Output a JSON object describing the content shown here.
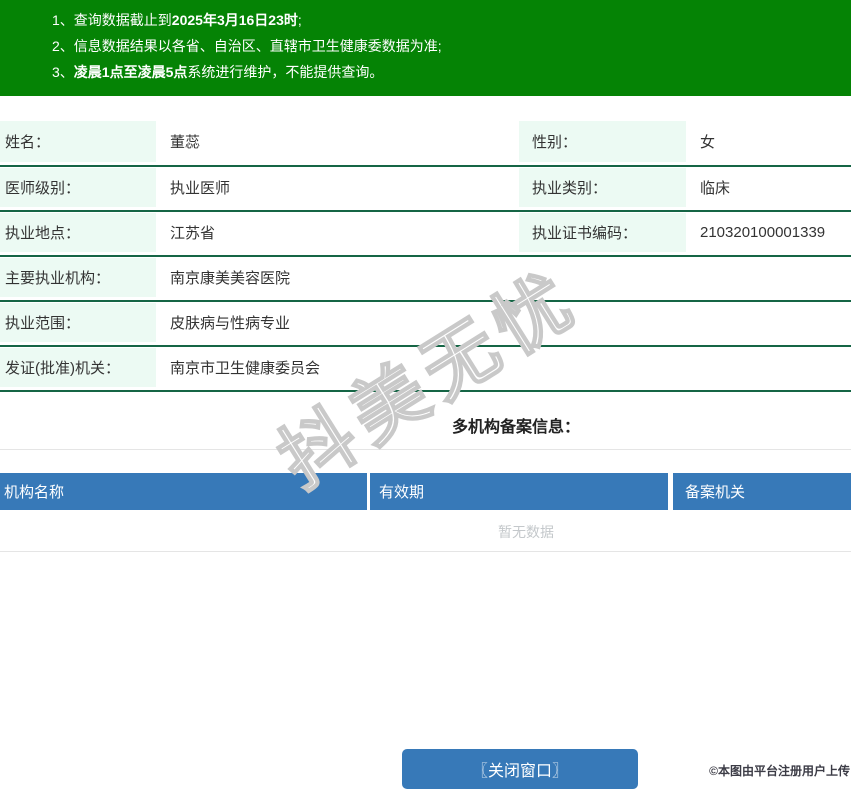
{
  "banner": {
    "lines": [
      {
        "pre": "1、查询数据截止到",
        "bold": "2025年3月16日23时",
        "post": ";"
      },
      {
        "pre": "2、信息数据结果以各省、自治区、直辖市卫生健康委数据为准;",
        "bold": "",
        "post": ""
      },
      {
        "pre": "3、",
        "bold": "凌晨1点至凌晨5点",
        "post": "系统进行维护，不能提供查询。"
      }
    ]
  },
  "info": {
    "rows": [
      {
        "label": "姓名：",
        "value": "董蕊",
        "label2": "性别：",
        "value2": "女"
      },
      {
        "label": "医师级别：",
        "value": "执业医师",
        "label2": "执业类别：",
        "value2": "临床"
      },
      {
        "label": "执业地点：",
        "value": "江苏省",
        "label2": "执业证书编码：",
        "value2": "210320100001339"
      },
      {
        "label": "主要执业机构：",
        "value": "南京康美美容医院"
      },
      {
        "label": "执业范围：",
        "value": "皮肤病与性病专业"
      },
      {
        "label": "发证(批准)机关：",
        "value": "南京市卫生健康委员会"
      }
    ]
  },
  "records": {
    "section_title": "多机构备案信息：",
    "columns": [
      "机构名称",
      "有效期",
      "备案机关"
    ],
    "empty_text": "暂无数据"
  },
  "watermark": {
    "text": "抖美无忧"
  },
  "footer": {
    "close_button": "〖关闭窗口〗",
    "copyright": "©本图由平台注册用户上传"
  },
  "colors": {
    "banner_green": "#058305",
    "row_line_green": "#156545",
    "label_bg_mint": "#ecfaf3",
    "header_blue": "#3779b8",
    "empty_text_grey": "#c4c8cb"
  }
}
